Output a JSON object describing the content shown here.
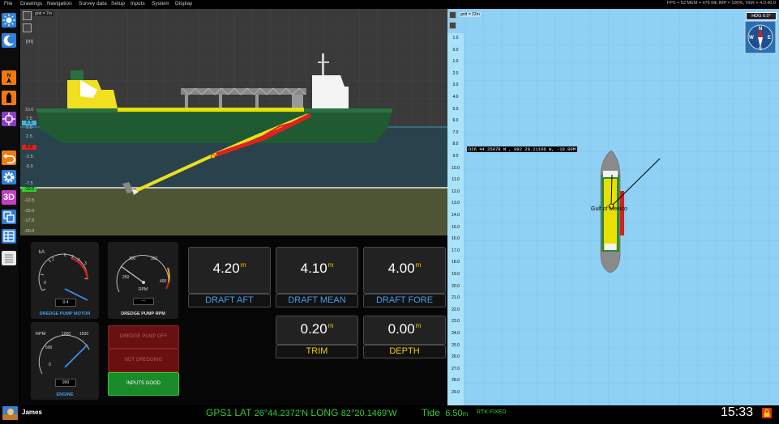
{
  "menu": [
    "File",
    "Drawings",
    "Navigation",
    "Survey data",
    "Setup",
    "Inputs",
    "System",
    "Display"
  ],
  "system_info": "FPS = 52 MEM = 476 Mb IMP = 100%, VER = 4.0.40.0",
  "toolbar": [
    {
      "name": "sun-icon",
      "color": "#2f7fd8"
    },
    {
      "name": "moon-icon",
      "color": "#2f7fd8"
    },
    {
      "name": "north-up-icon",
      "color": "#f07a10"
    },
    {
      "name": "ship-orientation-icon",
      "color": "#f07a10"
    },
    {
      "name": "crosshair-icon",
      "color": "#8c3cc8"
    },
    {
      "name": "undo-icon",
      "color": "#f07a10"
    },
    {
      "name": "gear-icon",
      "color": "#2f7fd8"
    },
    {
      "name": "3d-icon",
      "color": "#c83cc8",
      "label": "3D"
    },
    {
      "name": "layers-icon",
      "color": "#2f7fd8"
    },
    {
      "name": "table-icon",
      "color": "#2f7fd8"
    },
    {
      "name": "notes-icon",
      "color": "#e8e8e8"
    }
  ],
  "profile": {
    "grid_label": "grid = 7m",
    "unit": "(m)",
    "scale": [
      "10.0",
      "7.5",
      "6.5",
      "5.0",
      "2.5",
      "0.0",
      "-2.5",
      "-5.0",
      "-7.5",
      "-10.0",
      "-12.5",
      "-15.0",
      "-17.5",
      "-20.0",
      "-22.5"
    ],
    "waterline_marker": "6.5",
    "zero_marker": "0.0",
    "depth_marker": "-10.0"
  },
  "gauges": {
    "pump_motor": {
      "title": "DREDGE PUMP MOTOR",
      "unit": "kA",
      "ticks": [
        "0",
        "1",
        "2",
        "3"
      ],
      "readout": "0.4"
    },
    "pump_rpm": {
      "title": "DREDGE PUMP RPM",
      "unit": "RPM",
      "ticks": [
        "250",
        "300",
        "350",
        "400"
      ],
      "readout": "---"
    },
    "engine": {
      "title": "ENGINE",
      "unit": "RPM",
      "ticks": [
        "0",
        "500",
        "1000",
        "1500"
      ],
      "readout": "999"
    }
  },
  "status_buttons": [
    {
      "label": "DREDGE PUMP OFF",
      "bg": "#6a1010",
      "color": "#b06060"
    },
    {
      "label": "NOT DREDGING",
      "bg": "#6a1010",
      "color": "#b06060"
    },
    {
      "label": "INPUTS GOOD",
      "bg": "#1a8a2a",
      "color": "#ffffff"
    }
  ],
  "readouts": [
    {
      "value": "4.20",
      "unit": "m",
      "label": "DRAFT AFT",
      "label_color": "#3f9ff0"
    },
    {
      "value": "4.10",
      "unit": "m",
      "label": "DRAFT MEAN",
      "label_color": "#3f9ff0"
    },
    {
      "value": "4.00",
      "unit": "m",
      "label": "DRAFT FORE",
      "label_color": "#3f9ff0"
    },
    {
      "value": "0.20",
      "unit": "m",
      "label": "TRIM",
      "label_color": "#f2d000"
    },
    {
      "value": "0.00",
      "unit": "m",
      "label": "DEPTH",
      "label_color": "#f2d000"
    }
  ],
  "map": {
    "grid_label": "grid = 22m",
    "compass_label": "HDG 0.0°",
    "compass_letters": [
      "N",
      "E",
      "S",
      "W"
    ],
    "depths": [
      "1.0",
      "0.0",
      "1.0",
      "2.0",
      "3.0",
      "4.0",
      "5.0",
      "6.0",
      "7.0",
      "8.0",
      "9.0",
      "10.0",
      "11.0",
      "12.0",
      "13.0",
      "14.0",
      "15.0",
      "16.0",
      "17.0",
      "18.0",
      "19.0",
      "20.0",
      "21.0",
      "22.0",
      "23.0",
      "24.0",
      "25.0",
      "26.0",
      "27.0",
      "28.0",
      "29.0"
    ],
    "cursor_readout": "D26 44.25878 N , 082 20.21166 W, -10.00M",
    "place_label": "Gulf of Mexico"
  },
  "status": {
    "user": "James",
    "gps": "GPS1",
    "lat_label": "LAT",
    "lat": "26°44.2372'N",
    "long_label": "LONG",
    "long": "82°20.1469'W",
    "tide_label": "Tide",
    "tide": "6.50",
    "tide_unit": "m",
    "fix": "RTK FIXED",
    "time": "15:33"
  }
}
